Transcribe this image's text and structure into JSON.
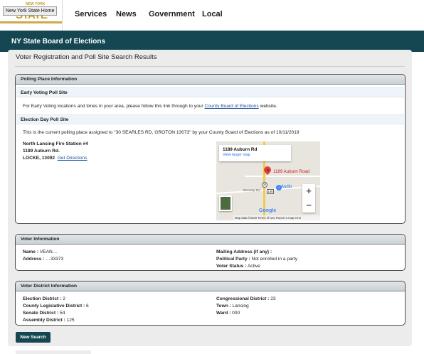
{
  "header": {
    "logo_small_text": "NEW YORK",
    "logo_text": "STATE",
    "tooltip": "New York State Home",
    "nav": [
      "Services",
      "News",
      "Government",
      "Local"
    ]
  },
  "banner": {
    "title": "NY State Board of Elections"
  },
  "page": {
    "title": "Voter Registration and Poll Site Search Results"
  },
  "polling": {
    "header": "Polling Place Information",
    "early_title": "Early Voting Poll Site",
    "early_text_pre": "For Early Voting locations and times in your area, please follow this link through to your ",
    "early_link": "County Board of Elections",
    "early_text_post": " website.",
    "eday_title": "Election Day Poll Site",
    "eday_text": "This is the current polling place assigned to \"30 SEARLES RD, GROTON 13073\" by your County Board of Elections as of 10/11/2019",
    "site_name": "North Lansing Fire Station #4",
    "site_addr1": "1189 Auburn Rd.",
    "site_addr2": "LOCKE, 13092",
    "directions": "Get Directions",
    "map": {
      "info_title": "1189 Auburn Rd",
      "info_link": "View larger map",
      "pin_label": "1189 Auburn Road",
      "route1": "34",
      "route2": "156",
      "road": "Decamp Rd",
      "poi": "Audio",
      "zoom_in": "+",
      "zoom_out": "−",
      "logo": "Google",
      "footer": "Map data ©2020    Terms of Use    Report a map error"
    }
  },
  "voter": {
    "header": "Voter Information",
    "name_label": "Name :",
    "name_value": "VEAN…",
    "address_label": "Address :",
    "address_value": "…33373",
    "mailing_label": "Mailing Address (if any) :",
    "party_label": "Political Party :",
    "party_value": "Not enrolled in a party",
    "status_label": "Voter Status :",
    "status_value": "Active"
  },
  "district": {
    "header": "Voter District Information",
    "left": [
      {
        "label": "Election District :",
        "value": "2"
      },
      {
        "label": "County Legislative District :",
        "value": "6"
      },
      {
        "label": "Senate District :",
        "value": "54"
      },
      {
        "label": "Assembly District :",
        "value": "125"
      }
    ],
    "right": [
      {
        "label": "Congressional District :",
        "value": "23"
      },
      {
        "label": "Town :",
        "value": "Lansing"
      },
      {
        "label": "Ward :",
        "value": "000"
      }
    ]
  },
  "actions": {
    "new_search": "New Search"
  }
}
